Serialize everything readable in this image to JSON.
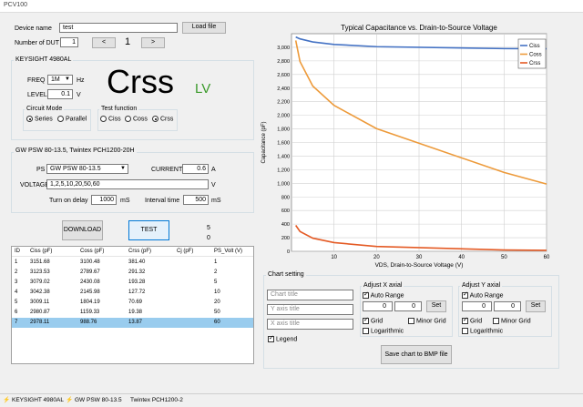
{
  "window": {
    "title": "PCV100"
  },
  "device": {
    "label": "Device name",
    "value": "test",
    "load_button": "Load file",
    "dut_label": "Number of DUT",
    "dut_value": "1",
    "prev": "<",
    "next": ">",
    "current": "1"
  },
  "keysight": {
    "title": "KEYSIGHT 4980AL",
    "freq_label": "FREQ",
    "freq_value": "1M",
    "freq_unit": "Hz",
    "level_label": "LEVEL",
    "level_value": "0.1",
    "level_unit": "V",
    "big_label": "Crss",
    "lv_label": "LV",
    "circuit_mode_title": "Circuit Mode",
    "series": "Series",
    "parallel": "Parallel",
    "test_function_title": "Test function",
    "ciss": "Ciss",
    "coss": "Coss",
    "crss": "Crss"
  },
  "psu": {
    "title": "GW PSW 80-13.5, Twintex PCH1200-20H",
    "ps_label": "PS",
    "ps_value": "GW PSW 80-13.5",
    "current_label": "CURRENT",
    "current_value": "0.6",
    "current_unit": "A",
    "voltage_label": "VOLTAGE",
    "voltage_value": "1,2,5,10,20,50,60",
    "voltage_unit": "V",
    "turn_on_label": "Turn on delay",
    "turn_on_value": "1000",
    "turn_on_unit": "mS",
    "interval_label": "Interval time",
    "interval_value": "500",
    "interval_unit": "mS"
  },
  "actions": {
    "download": "DOWNLOAD",
    "test": "TEST",
    "count_a": "5",
    "count_b": "0"
  },
  "table": {
    "columns": [
      "ID",
      "Ciss (pF)",
      "Coss (pF)",
      "Crss (pF)",
      "Cj (pF)",
      "PS_Volt (V)"
    ],
    "rows": [
      [
        "1",
        "3151.68",
        "3100.48",
        "381.40",
        "",
        "1"
      ],
      [
        "2",
        "3123.53",
        "2789.67",
        "291.32",
        "",
        "2"
      ],
      [
        "3",
        "3079.02",
        "2430.08",
        "193.28",
        "",
        "5"
      ],
      [
        "4",
        "3042.38",
        "2145.98",
        "127.72",
        "",
        "10"
      ],
      [
        "5",
        "3009.11",
        "1804.19",
        "70.69",
        "",
        "20"
      ],
      [
        "6",
        "2980.87",
        "1159.33",
        "19.38",
        "",
        "50"
      ],
      [
        "7",
        "2978.11",
        "988.76",
        "13.87",
        "",
        "60"
      ]
    ]
  },
  "chart_settings": {
    "title": "Chart setting",
    "chart_title_ph": "Chart title",
    "y_title_ph": "Y axis title",
    "x_title_ph": "X axis title",
    "legend": "Legend",
    "x_group": "Adjust X axial",
    "y_group": "Adjust Y axial",
    "auto_range": "Auto Range",
    "x_min": "0",
    "x_max": "0",
    "y_min": "0",
    "y_max": "0",
    "set": "Set",
    "grid": "Grid",
    "minor_grid": "Minor Grid",
    "log": "Logarithmic",
    "save": "Save chart to BMP file"
  },
  "status": {
    "item1": "KEYSIGHT 4980AL",
    "item2": "GW PSW 80-13.5",
    "item3": "Twintex PCH1200-2"
  },
  "chart_data": {
    "type": "line",
    "title": "Typical Capacitance vs. Drain-to-Source Voltage",
    "xlabel": "VDS, Drain-to-Source Voltage (V)",
    "ylabel": "Capacitance (pF)",
    "xlim": [
      0,
      60
    ],
    "ylim": [
      0,
      3200
    ],
    "xticks": [
      10,
      20,
      30,
      40,
      50,
      60
    ],
    "yticks": [
      0,
      200,
      400,
      600,
      800,
      1000,
      1200,
      1400,
      1600,
      1800,
      2000,
      2200,
      2400,
      2600,
      2800,
      3000
    ],
    "x": [
      1,
      2,
      5,
      10,
      20,
      50,
      60
    ],
    "series": [
      {
        "name": "Ciss",
        "color": "#4472c4",
        "values": [
          3151.68,
          3123.53,
          3079.02,
          3042.38,
          3009.11,
          2980.87,
          2978.11
        ]
      },
      {
        "name": "Coss",
        "color": "#ed9a3a",
        "values": [
          3100.48,
          2789.67,
          2430.08,
          2145.98,
          1804.19,
          1159.33,
          988.76
        ]
      },
      {
        "name": "Crss",
        "color": "#e45a24",
        "values": [
          381.4,
          291.32,
          193.28,
          127.72,
          70.69,
          19.38,
          13.87
        ]
      }
    ],
    "grid": true,
    "legend": "top-right"
  }
}
